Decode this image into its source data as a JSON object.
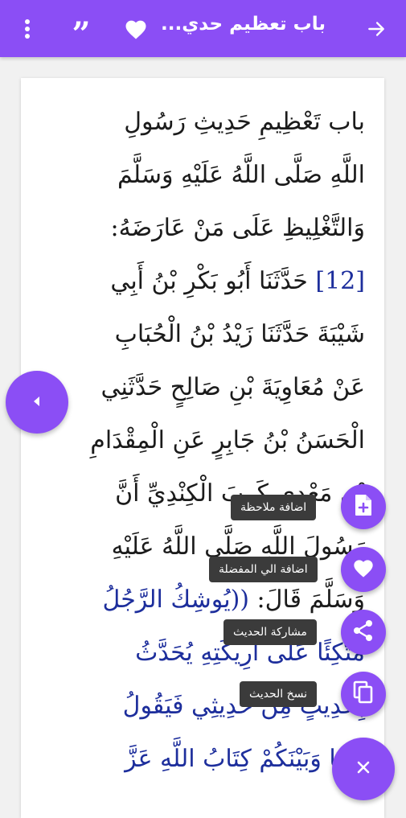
{
  "header": {
    "title": "باب تعظيم حدي...",
    "back_icon": "arrow-forward-icon",
    "favorite_icon": "heart-icon",
    "quote_icon": "quote-icon",
    "menu_icon": "more-vert-icon",
    "background": "#8b4ef5"
  },
  "hadith": {
    "line1": "باب تَعْظِيمِ حَدِيثِ رَسُولِ",
    "line2": "اللَّهِ صَلَّى اللَّهُ عَلَيْهِ وَسَلَّمَ",
    "line3": "وَالتَّغْلِيظِ عَلَى مَنْ عَارَضَهُ:",
    "number": "[12]",
    "line4_rest": " حَدَّثَنَا أَبُو بَكْرِ بْنُ أَبِي",
    "line5": "شَيْبَةَ حَدَّثَنَا زَيْدُ بْنُ الْحُبَابِ",
    "line6": "عَنْ مُعَاوِيَةَ بْنِ صَالِحٍ حَدَّثَنِي",
    "line7": "الْحَسَنُ بْنُ جَابِرٍ عَنِ الْمِقْدَامِ",
    "line8": "بْنِ مَعْدِي كَرِبَ الْكِنْدِيِّ أَنَّ",
    "line9": "رَسُولَ اللَّهِ صَلَّى اللَّهُ عَلَيْهِ",
    "line10_plain": "وَسَلَّمَ قَالَ: ",
    "line10_quote": "((يُوشِكُ الرَّجُلُ",
    "line11": "مُتَّكِئًا عَلَى أَرِيكَتِهِ يُحَدَّثُ",
    "line12": "بِحَدِيثٍ مِنْ حَدِيثِي فَيَقُولُ",
    "line13": "بَيْنَنَا وَبَيْنَكُمْ كِتَابُ اللَّهِ عَزَّ"
  },
  "fab_menu": {
    "add_note": "اضافة ملاحظة",
    "add_favorite": "اضافة الي المفضلة",
    "share": "مشاركة الحديث",
    "copy": "نسخ الحديث"
  },
  "colors": {
    "accent": "#8b4ef5",
    "hadith_quote": "#1d2e9c",
    "label_bg": "#3b3b3b"
  }
}
